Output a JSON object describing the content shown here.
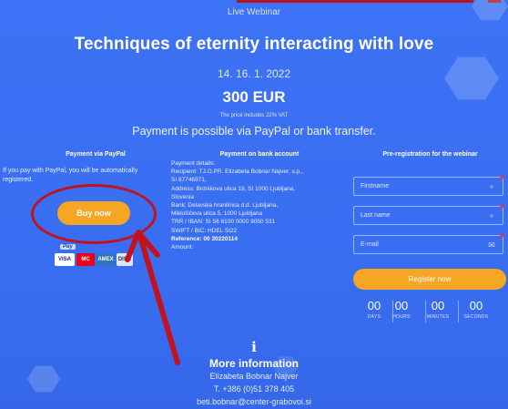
{
  "header": {
    "label": "Live Webinar",
    "title": "Techniques of eternity interacting with love",
    "dates": "14. 16. 1. 2022",
    "price": "300 EUR",
    "vat_note": "The price includes 22% VAT",
    "payment_note": "Payment is possible via PayPal or bank transfer."
  },
  "paypal": {
    "heading": "Payment via PayPal",
    "text": "If you pay with PayPal, you will be automatically registered.",
    "buy_label": "Buy now",
    "badge": "Pay",
    "cards": [
      "VISA",
      "MC",
      "AMEX",
      "DISC"
    ]
  },
  "bank": {
    "heading": "Payment on bank account",
    "lines": [
      "Payment details:",
      "Recipient: TJ.O.PR. Elizabeta Bobnar Najver, s.p.,",
      "SI 67746971,",
      "Address: Brdnikova ulica 19, SI 1000 Ljubljana,",
      "Slovenia",
      "Bank: Delavska hranilnica d.d. Ljubljana,",
      "Miklošičeva ulica 5, 1000 Ljubljana",
      "TRR / IBAN: SI 56 6100 0000 9050 531",
      "SWIFT / BIC: HDEL SI22",
      "Reference: 00 20220114",
      "Amount:"
    ]
  },
  "registration": {
    "heading": "Pre-registration for the webinar",
    "firstname_placeholder": "Firstname",
    "lastname_placeholder": "Last name",
    "email_placeholder": "E-mail",
    "register_label": "Register now",
    "countdown": [
      {
        "value": "00",
        "label": "DAYS"
      },
      {
        "value": "00",
        "label": "HOURS"
      },
      {
        "value": "00",
        "label": "MINUTES"
      },
      {
        "value": "00",
        "label": "SECONDS"
      }
    ]
  },
  "footer": {
    "icon": "info-icon",
    "title": "More information",
    "name": "Elizabeta Bobnar Najver",
    "phone": "T. +386 (0)51 378 405",
    "email": "beti.bobnar@center-grabovoi.si"
  },
  "colors": {
    "background": "#3a6ff0",
    "accent": "#f5a623",
    "annotation": "#c1121f"
  }
}
